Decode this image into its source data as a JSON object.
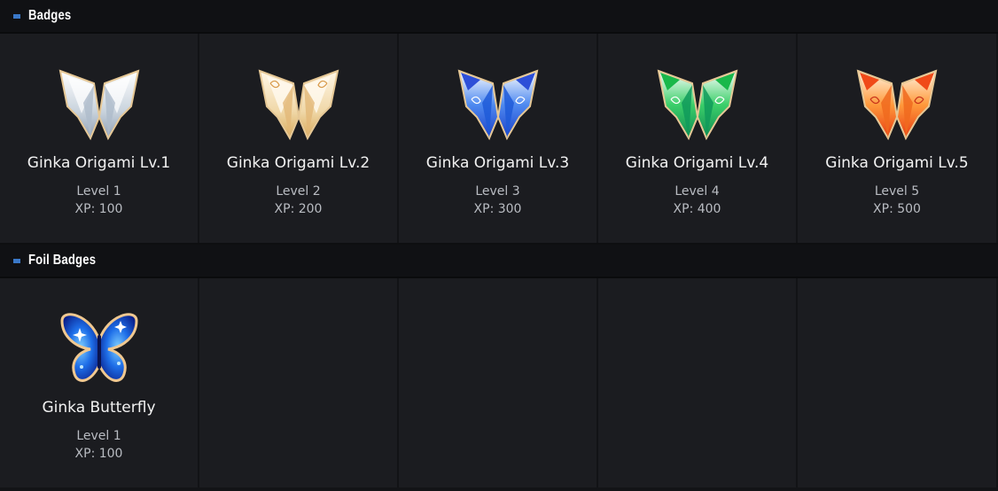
{
  "sections": [
    {
      "title": "Badges",
      "badges": [
        {
          "name": "Ginka Origami Lv.1",
          "level": "Level 1",
          "xp": "XP: 100",
          "icon": "silver-origami-butterfly-icon",
          "colors": [
            "#ffffff",
            "#c9d3dd",
            "#8fa0b5"
          ]
        },
        {
          "name": "Ginka Origami Lv.2",
          "level": "Level 2",
          "xp": "XP: 200",
          "icon": "cream-origami-butterfly-icon",
          "colors": [
            "#fff6e6",
            "#f0d8a8",
            "#d8a95a"
          ]
        },
        {
          "name": "Ginka Origami Lv.3",
          "level": "Level 3",
          "xp": "XP: 300",
          "icon": "blue-origami-butterfly-icon",
          "colors": [
            "#ffffff",
            "#4f8af0",
            "#1a3fc8"
          ]
        },
        {
          "name": "Ginka Origami Lv.4",
          "level": "Level 4",
          "xp": "XP: 400",
          "icon": "green-origami-butterfly-icon",
          "colors": [
            "#ffffff",
            "#3ccf6a",
            "#0e8a52"
          ]
        },
        {
          "name": "Ginka Origami Lv.5",
          "level": "Level 5",
          "xp": "XP: 500",
          "icon": "orange-origami-butterfly-icon",
          "colors": [
            "#fff3e0",
            "#ff9a3c",
            "#e83a10"
          ]
        }
      ]
    },
    {
      "title": "Foil Badges",
      "badges": [
        {
          "name": "Ginka Butterfly",
          "level": "Level 1",
          "xp": "XP: 100",
          "icon": "blue-foil-butterfly-icon",
          "colors": [
            "#7fd0ff",
            "#1e6ee8",
            "#0a1f8a"
          ]
        }
      ]
    }
  ]
}
